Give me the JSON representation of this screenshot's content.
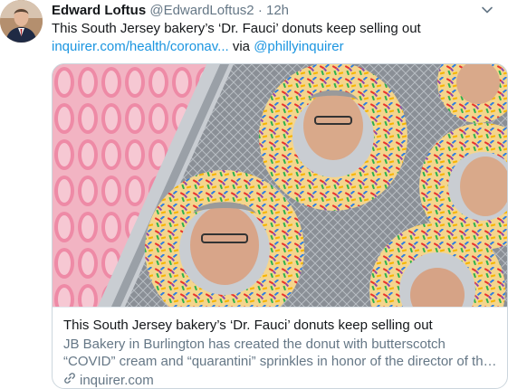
{
  "tweet": {
    "author_name": "Edward Loftus",
    "author_handle": "@EdwardLoftus2",
    "separator": "·",
    "time": "12h",
    "text": "This South Jersey bakery’s ‘Dr. Fauci’ donuts keep selling out",
    "link_text": "inquirer.com/health/coronav...",
    "via_text": "via",
    "mention": "@phillyinquirer"
  },
  "card": {
    "title": "This South Jersey bakery’s ‘Dr. Fauci’ donuts keep selling out",
    "description": "JB Bakery in Burlington has created the donut with butterscotch “COVID” cream and “quarantini” sprinkles in honor of the director of the Nationa...",
    "domain": "inquirer.com",
    "domain_icon": "link-icon"
  },
  "icons": {
    "menu": "chevron-down-icon"
  },
  "colors": {
    "link": "#1b95e0",
    "text": "#14171a",
    "muted": "#657786",
    "border": "#ccd6dd"
  }
}
